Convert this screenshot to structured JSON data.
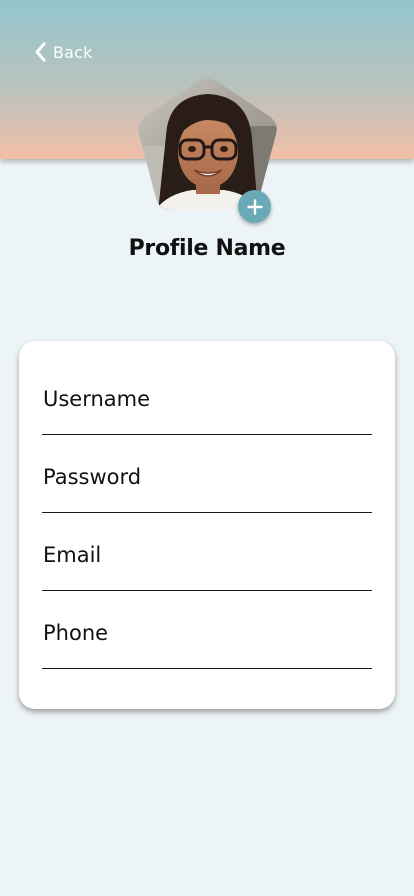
{
  "header": {
    "back_label": "Back",
    "back_icon": "chevron-left-icon",
    "gradient_top": "#93c6cd",
    "gradient_bottom": "#f2bfa7"
  },
  "profile": {
    "avatar": "profile-photo",
    "add_photo_icon": "plus-icon",
    "accent": "#6aa9b6",
    "name": "Profile Name"
  },
  "form": {
    "fields": [
      {
        "placeholder": "Username",
        "value": ""
      },
      {
        "placeholder": "Password",
        "value": ""
      },
      {
        "placeholder": "Email",
        "value": ""
      },
      {
        "placeholder": "Phone",
        "value": ""
      }
    ]
  }
}
